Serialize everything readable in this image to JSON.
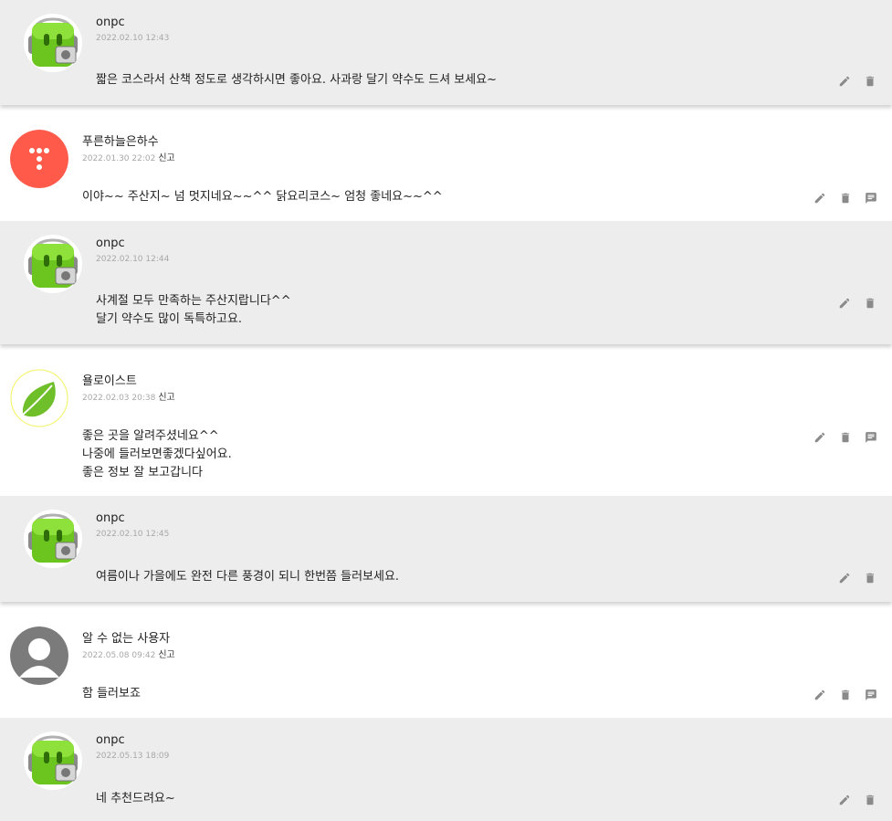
{
  "report_label": "신고",
  "entries": [
    {
      "type": "reply",
      "author": "onpc",
      "date": "2022.02.10 12:43",
      "lines": [
        "짧은 코스라서 산책 정도로 생각하시면 좋아요. 사과랑 달기 약수도 드셔 보세요~"
      ]
    },
    {
      "type": "comment",
      "author": "푸른하늘은하수",
      "date": "2022.01.30 22:02",
      "lines": [
        "이야~~ 주산지~ 넘 멋지네요~~^^ 닭요리코스~ 엄청 좋네요~~^^"
      ]
    },
    {
      "type": "reply",
      "author": "onpc",
      "date": "2022.02.10 12:44",
      "lines": [
        "사계절 모두 만족하는 주산지랍니다^^",
        "달기 약수도 많이 독특하고요."
      ]
    },
    {
      "type": "comment",
      "author": "욜로이스트",
      "date": "2022.02.03 20:38",
      "lines": [
        "좋은 곳을 알려주셨네요^^",
        "나중에 들러보면좋겠다싶어요.",
        "좋은 정보 잘 보고갑니다"
      ]
    },
    {
      "type": "reply",
      "author": "onpc",
      "date": "2022.02.10 12:45",
      "lines": [
        "여름이나 가을에도 완전 다른 풍경이 되니 한번쯤 들러보세요."
      ]
    },
    {
      "type": "comment",
      "author": "알 수 없는 사용자",
      "date": "2022.05.08 09:42",
      "lines": [
        "함 들러보죠"
      ]
    },
    {
      "type": "reply",
      "author": "onpc",
      "date": "2022.05.13 18:09",
      "lines": [
        "네 추천드려요~"
      ]
    }
  ],
  "icons": {
    "edit": "pencil-icon",
    "delete": "trash-icon",
    "reply": "chat-icon",
    "icon_color": "#8a8a8a"
  }
}
